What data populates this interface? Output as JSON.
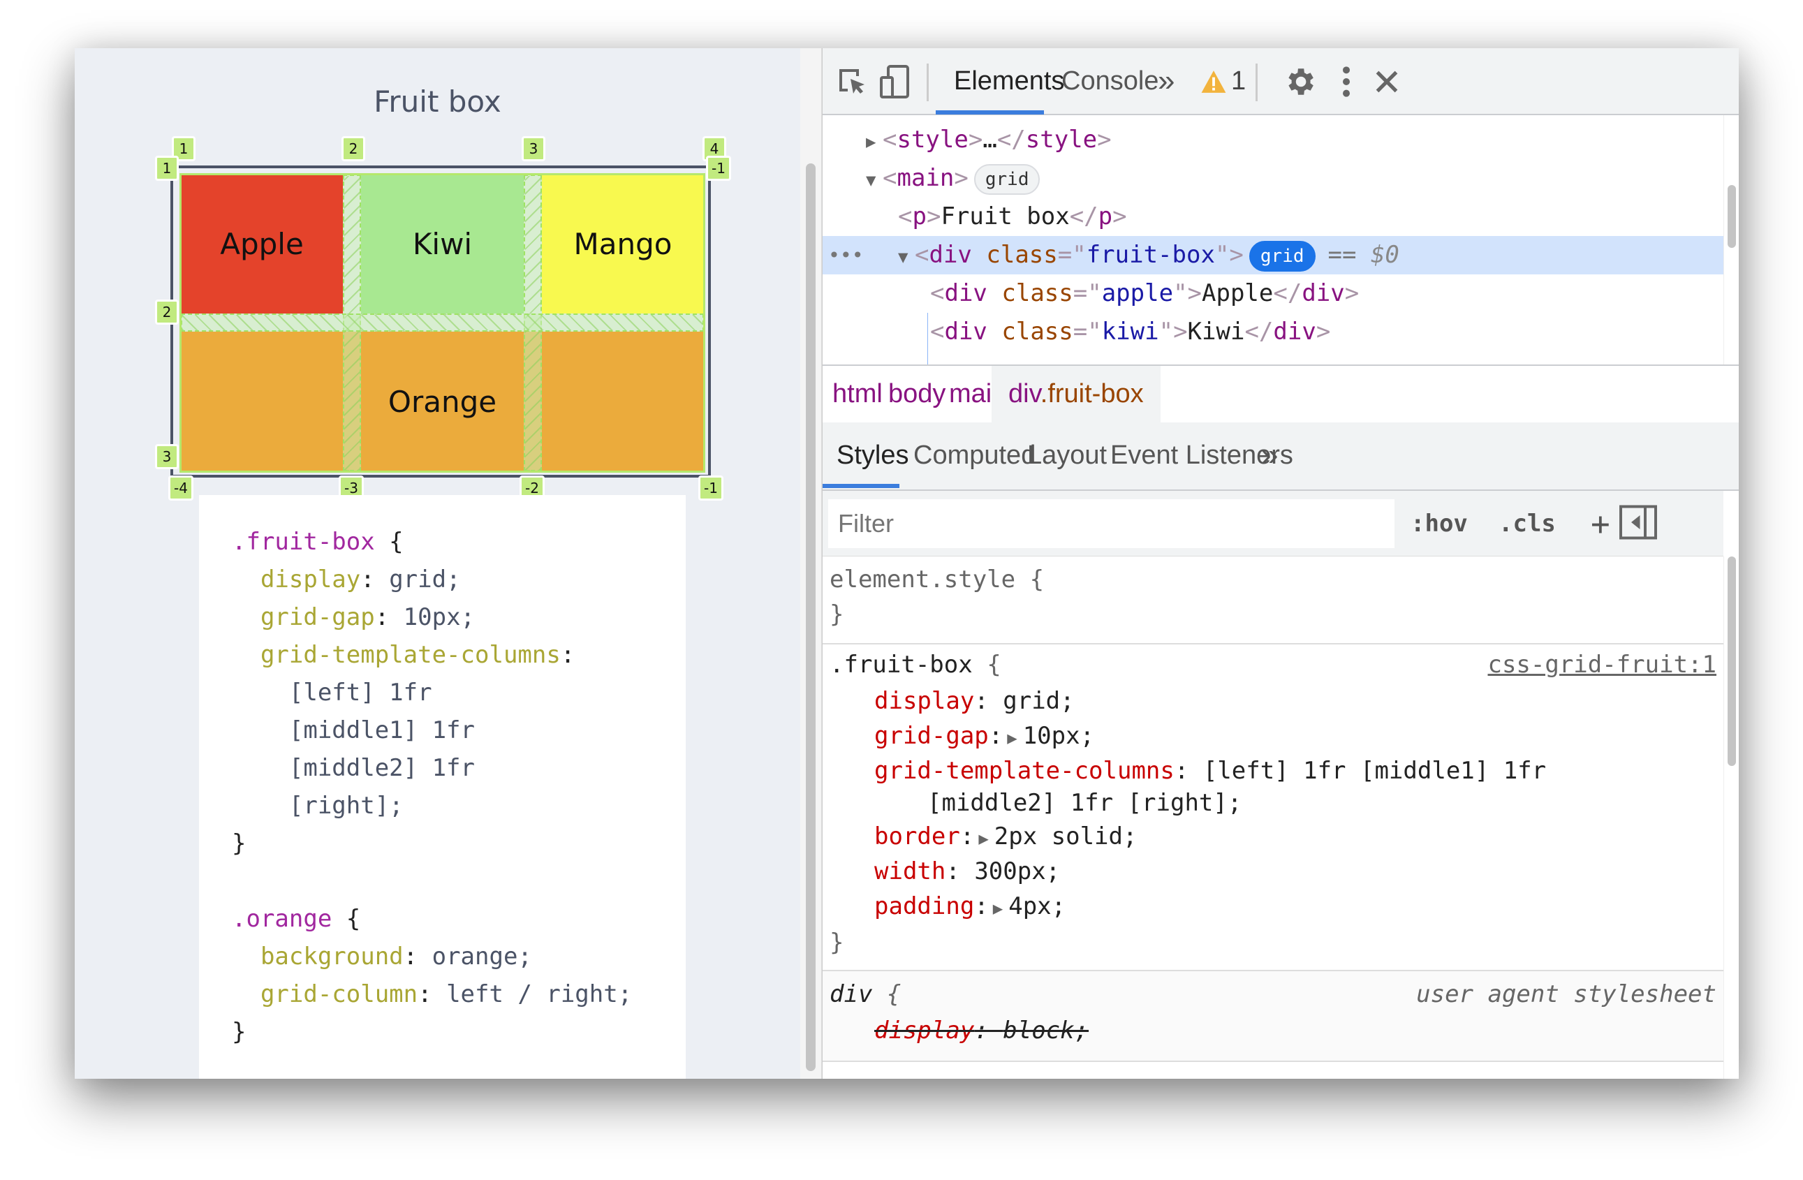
{
  "page": {
    "title": "Fruit box",
    "cells": {
      "apple": "Apple",
      "kiwi": "Kiwi",
      "mango": "Mango",
      "orange": "Orange"
    },
    "grid_overlay": {
      "column_line_labels_top": [
        "1",
        "2",
        "3",
        "4"
      ],
      "column_line_labels_bottom": [
        "-4",
        "-3",
        "-2",
        "-1"
      ],
      "row_line_labels_left": [
        "1",
        "2",
        "3"
      ],
      "row_line_labels_right": [
        "-1"
      ],
      "colors": {
        "label_bg": "#c1ea7f",
        "gap": "#9fe264",
        "border": "#4b5366"
      }
    },
    "code_blocks": [
      {
        "selector": ".fruit-box",
        "lines": [
          {
            "prop": "display",
            "value": "grid;"
          },
          {
            "prop": "grid-gap",
            "value": "10px;"
          },
          {
            "prop": "grid-template-columns",
            "value": ""
          },
          {
            "cont": "[left] 1fr"
          },
          {
            "cont": "[middle1] 1fr"
          },
          {
            "cont": "[middle2] 1fr"
          },
          {
            "cont": "[right];"
          }
        ]
      },
      {
        "selector": ".orange",
        "lines": [
          {
            "prop": "background",
            "value": "orange;"
          },
          {
            "prop": "grid-column",
            "value": "left / right;"
          }
        ]
      }
    ],
    "colors": {
      "apple": "#e4432b",
      "kiwi": "#a8e891",
      "mango": "#f8f94f",
      "orange": "#ebab3c"
    }
  },
  "devtools": {
    "toolbar": {
      "inspect_icon": "inspect-element-icon",
      "device_icon": "device-toolbar-icon",
      "tabs": [
        {
          "label": "Elements",
          "active": true
        },
        {
          "label": "Console",
          "active": false
        }
      ],
      "more_tabs": "»",
      "warning_count": "1",
      "settings_icon": "gear-icon",
      "menu_icon": "kebab-menu-icon",
      "close_icon": "close-icon"
    },
    "tree": {
      "rows": [
        {
          "open": "<",
          "tag": "style",
          "close": ">",
          "mid": "…",
          "endtag": "</style>"
        },
        {
          "tag": "main",
          "badge": "grid"
        },
        {
          "tag": "p",
          "text": "Fruit box"
        },
        {
          "tag": "div",
          "attr": "class",
          "val": "fruit-box",
          "badge": "grid",
          "selected_suffix": "==",
          "selected_var": "$0"
        },
        {
          "tag": "div",
          "attr": "class",
          "val": "apple",
          "text": "Apple"
        },
        {
          "tag": "div",
          "attr": "class",
          "val": "kiwi",
          "text": "Kiwi"
        }
      ],
      "row_menu": "•••"
    },
    "breadcrumbs": [
      "html",
      "body",
      "main",
      "div",
      ".fruit-box"
    ],
    "subtabs": [
      {
        "label": "Styles",
        "active": true
      },
      {
        "label": "Computed",
        "active": false
      },
      {
        "label": "Layout",
        "active": false
      },
      {
        "label": "Event Listeners",
        "active": false
      }
    ],
    "subtabs_more": "»",
    "filter": {
      "placeholder": "Filter",
      "hov": ":hov",
      "cls": ".cls",
      "plus": "+",
      "sidebar_toggle_icon": "toggle-sidebar-icon"
    },
    "styles": {
      "element_style": {
        "selector": "element.style {",
        "close": "}"
      },
      "fruit_box": {
        "selector": ".fruit-box",
        "brace": "{",
        "source": "css-grid-fruit:1",
        "decls": [
          {
            "name": "display",
            "value": "grid;",
            "expandable": false
          },
          {
            "name": "grid-gap",
            "value": "10px;",
            "expandable": true
          },
          {
            "name": "grid-template-columns",
            "value": "[left] 1fr [middle1] 1fr",
            "value2": "[middle2] 1fr [right];",
            "expandable": false
          },
          {
            "name": "border",
            "value": "2px solid;",
            "expandable": true
          },
          {
            "name": "width",
            "value": "300px;",
            "expandable": false
          },
          {
            "name": "padding",
            "value": "4px;",
            "expandable": true
          }
        ],
        "close": "}"
      },
      "ua_rule": {
        "selector": "div",
        "brace": "{",
        "source": "user agent stylesheet",
        "decls": [
          {
            "name": "display",
            "value": "block;",
            "overridden": true
          }
        ]
      }
    },
    "colors": {
      "accent": "#3b7ddd",
      "selected_row": "#d2e3fc",
      "warning": "#f2b33d"
    }
  }
}
